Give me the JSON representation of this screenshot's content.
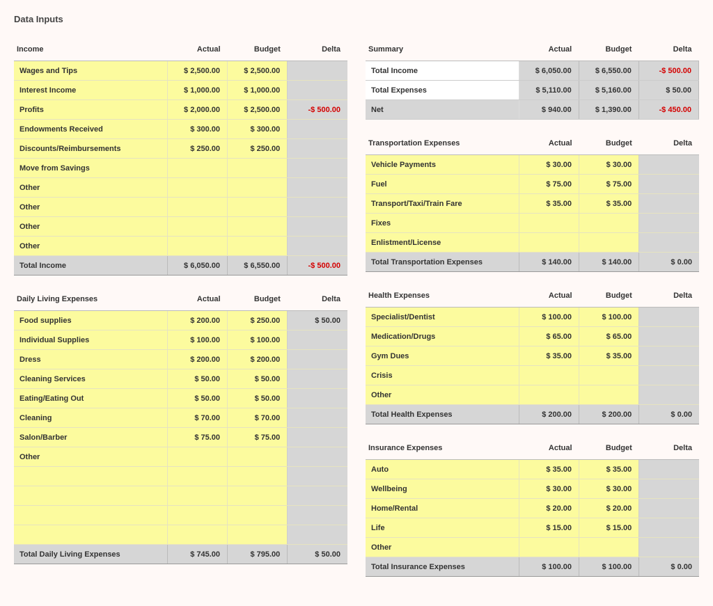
{
  "page_title": "Data Inputs",
  "headers": {
    "actual": "Actual",
    "budget": "Budget",
    "delta": "Delta"
  },
  "tables": {
    "income": {
      "title": "Income",
      "rows": [
        {
          "label": "Wages and Tips",
          "actual": "$ 2,500.00",
          "budget": "$ 2,500.00",
          "delta": ""
        },
        {
          "label": "Interest Income",
          "actual": "$ 1,000.00",
          "budget": "$ 1,000.00",
          "delta": ""
        },
        {
          "label": "Profits",
          "actual": "$ 2,000.00",
          "budget": "$ 2,500.00",
          "delta": "-$ 500.00",
          "neg": true
        },
        {
          "label": "Endowments Received",
          "actual": "$ 300.00",
          "budget": "$ 300.00",
          "delta": ""
        },
        {
          "label": "Discounts/Reimbursements",
          "actual": "$ 250.00",
          "budget": "$ 250.00",
          "delta": ""
        },
        {
          "label": "Move from Savings",
          "actual": "",
          "budget": "",
          "delta": ""
        },
        {
          "label": "Other",
          "actual": "",
          "budget": "",
          "delta": ""
        },
        {
          "label": "Other",
          "actual": "",
          "budget": "",
          "delta": ""
        },
        {
          "label": "Other",
          "actual": "",
          "budget": "",
          "delta": ""
        },
        {
          "label": "Other",
          "actual": "",
          "budget": "",
          "delta": ""
        }
      ],
      "total": {
        "label": "Total Income",
        "actual": "$ 6,050.00",
        "budget": "$ 6,550.00",
        "delta": "-$ 500.00",
        "neg": true
      }
    },
    "daily": {
      "title": "Daily Living Expenses",
      "rows": [
        {
          "label": "Food supplies",
          "actual": "$ 200.00",
          "budget": "$ 250.00",
          "delta": "$ 50.00"
        },
        {
          "label": "Individual Supplies",
          "actual": "$ 100.00",
          "budget": "$ 100.00",
          "delta": ""
        },
        {
          "label": "Dress",
          "actual": "$ 200.00",
          "budget": "$ 200.00",
          "delta": ""
        },
        {
          "label": "Cleaning Services",
          "actual": "$ 50.00",
          "budget": "$ 50.00",
          "delta": ""
        },
        {
          "label": "Eating/Eating Out",
          "actual": "$ 50.00",
          "budget": "$ 50.00",
          "delta": ""
        },
        {
          "label": "Cleaning",
          "actual": "$ 70.00",
          "budget": "$ 70.00",
          "delta": ""
        },
        {
          "label": "Salon/Barber",
          "actual": "$ 75.00",
          "budget": "$ 75.00",
          "delta": ""
        },
        {
          "label": "Other",
          "actual": "",
          "budget": "",
          "delta": ""
        },
        {
          "label": "",
          "actual": "",
          "budget": "",
          "delta": ""
        },
        {
          "label": "",
          "actual": "",
          "budget": "",
          "delta": ""
        },
        {
          "label": "",
          "actual": "",
          "budget": "",
          "delta": ""
        },
        {
          "label": "",
          "actual": "",
          "budget": "",
          "delta": ""
        }
      ],
      "total": {
        "label": "Total Daily Living Expenses",
        "actual": "$ 745.00",
        "budget": "$ 795.00",
        "delta": "$ 50.00"
      }
    },
    "summary": {
      "title": "Summary",
      "rows": [
        {
          "label": "Total Income",
          "actual": "$ 6,050.00",
          "budget": "$ 6,550.00",
          "delta": "-$ 500.00",
          "neg": true
        },
        {
          "label": "Total Expenses",
          "actual": "$ 5,110.00",
          "budget": "$ 5,160.00",
          "delta": "$ 50.00"
        }
      ],
      "net": {
        "label": "Net",
        "actual": "$ 940.00",
        "budget": "$ 1,390.00",
        "delta": "-$ 450.00",
        "neg": true
      }
    },
    "transport": {
      "title": "Transportation Expenses",
      "rows": [
        {
          "label": "Vehicle Payments",
          "actual": "$ 30.00",
          "budget": "$ 30.00",
          "delta": ""
        },
        {
          "label": "Fuel",
          "actual": "$ 75.00",
          "budget": "$ 75.00",
          "delta": ""
        },
        {
          "label": "Transport/Taxi/Train Fare",
          "actual": "$ 35.00",
          "budget": "$ 35.00",
          "delta": ""
        },
        {
          "label": "Fixes",
          "actual": "",
          "budget": "",
          "delta": ""
        },
        {
          "label": "Enlistment/License",
          "actual": "",
          "budget": "",
          "delta": ""
        }
      ],
      "total": {
        "label": "Total Transportation Expenses",
        "actual": "$ 140.00",
        "budget": "$ 140.00",
        "delta": "$ 0.00"
      }
    },
    "health": {
      "title": "Health Expenses",
      "rows": [
        {
          "label": "Specialist/Dentist",
          "actual": "$ 100.00",
          "budget": "$ 100.00",
          "delta": ""
        },
        {
          "label": "Medication/Drugs",
          "actual": "$ 65.00",
          "budget": "$ 65.00",
          "delta": ""
        },
        {
          "label": "Gym Dues",
          "actual": "$ 35.00",
          "budget": "$ 35.00",
          "delta": ""
        },
        {
          "label": "Crisis",
          "actual": "",
          "budget": "",
          "delta": ""
        },
        {
          "label": "Other",
          "actual": "",
          "budget": "",
          "delta": ""
        }
      ],
      "total": {
        "label": "Total Health Expenses",
        "actual": "$ 200.00",
        "budget": "$ 200.00",
        "delta": "$ 0.00"
      }
    },
    "insurance": {
      "title": "Insurance Expenses",
      "rows": [
        {
          "label": "Auto",
          "actual": "$ 35.00",
          "budget": "$ 35.00",
          "delta": ""
        },
        {
          "label": "Wellbeing",
          "actual": "$ 30.00",
          "budget": "$ 30.00",
          "delta": ""
        },
        {
          "label": "Home/Rental",
          "actual": "$ 20.00",
          "budget": "$ 20.00",
          "delta": ""
        },
        {
          "label": "Life",
          "actual": "$ 15.00",
          "budget": "$ 15.00",
          "delta": ""
        },
        {
          "label": "Other",
          "actual": "",
          "budget": "",
          "delta": ""
        }
      ],
      "total": {
        "label": "Total Insurance Expenses",
        "actual": "$ 100.00",
        "budget": "$ 100.00",
        "delta": "$ 0.00"
      }
    }
  }
}
